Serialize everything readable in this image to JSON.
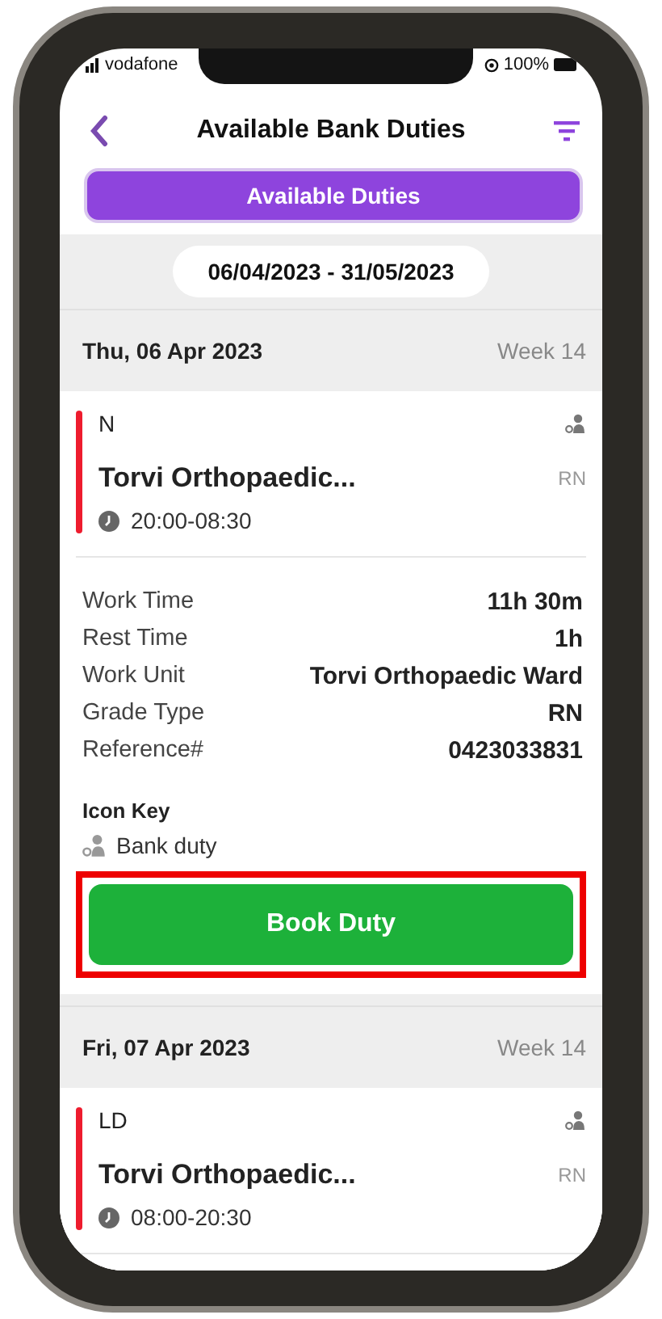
{
  "status_bar": {
    "carrier": "vodafone",
    "battery": "100%"
  },
  "header": {
    "title": "Available Bank Duties"
  },
  "tabs": [
    {
      "label": "Available Duties",
      "selected": true
    }
  ],
  "date_range": "06/04/2023 - 31/05/2023",
  "days": [
    {
      "date": "Thu, 06 Apr 2023",
      "week": "Week 14",
      "duties": [
        {
          "code": "N",
          "ward": "Torvi Orthopaedic...",
          "grade": "RN",
          "time": "20:00-08:30",
          "details": [
            {
              "label": "Work Time",
              "value": "11h 30m"
            },
            {
              "label": "Rest Time",
              "value": "1h"
            },
            {
              "label": "Work Unit",
              "value": "Torvi Orthopaedic Ward"
            },
            {
              "label": "Grade Type",
              "value": "RN"
            },
            {
              "label": "Reference#",
              "value": "0423033831"
            }
          ],
          "icon_key": {
            "title": "Icon Key",
            "items": [
              "Bank duty"
            ]
          },
          "action": {
            "label": "Book Duty",
            "highlighted": true
          }
        }
      ]
    },
    {
      "date": "Fri, 07 Apr 2023",
      "week": "Week 14",
      "duties": [
        {
          "code": "LD",
          "ward": "Torvi Orthopaedic...",
          "grade": "RN",
          "time": "08:00-20:30"
        }
      ]
    }
  ]
}
